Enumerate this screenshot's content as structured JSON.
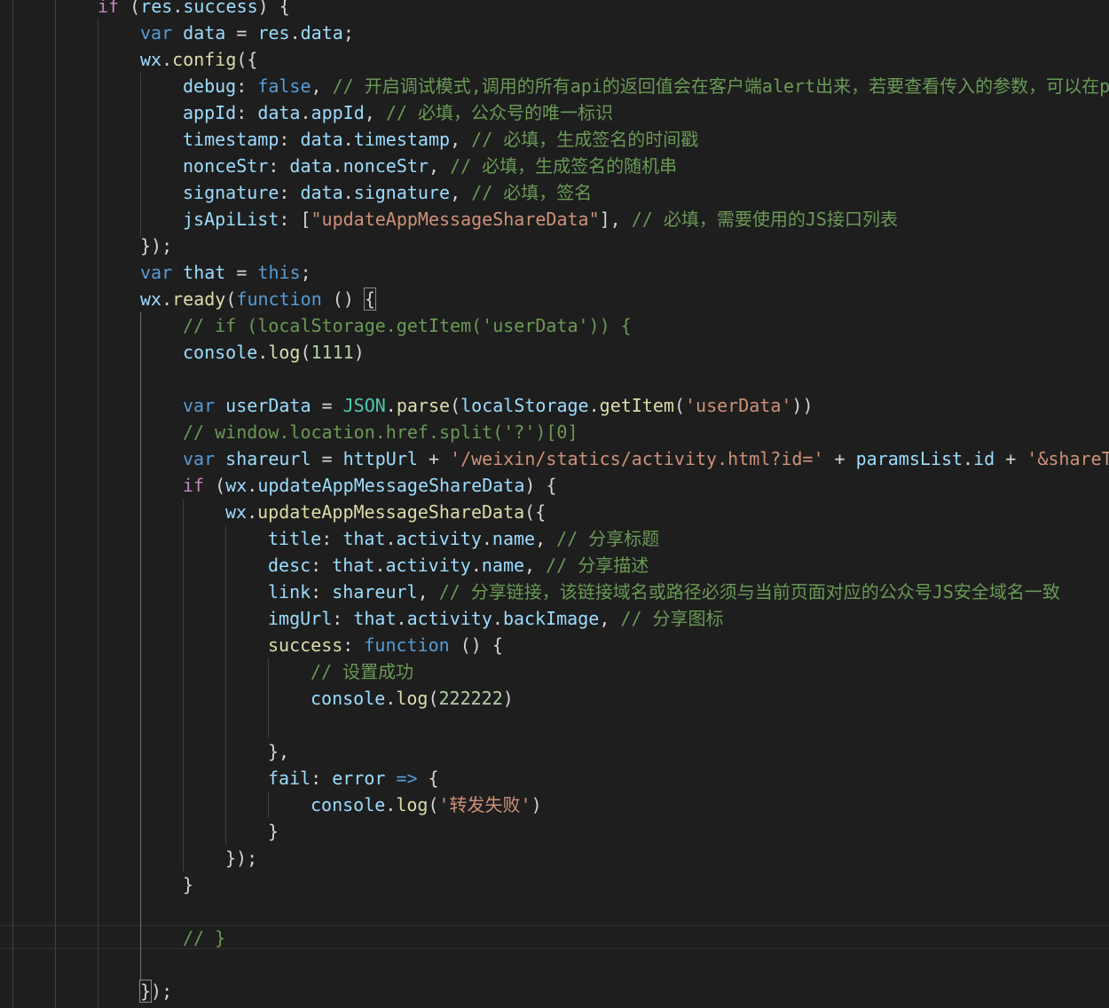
{
  "editor": {
    "lines": [
      {
        "indent": 110,
        "tokens": [
          {
            "t": "if",
            "c": "ctl"
          },
          {
            "t": " (",
            "c": "p"
          },
          {
            "t": "res",
            "c": "var"
          },
          {
            "t": ".",
            "c": "p"
          },
          {
            "t": "success",
            "c": "var"
          },
          {
            "t": ") {",
            "c": "p"
          }
        ]
      },
      {
        "indent": 158,
        "tokens": [
          {
            "t": "var",
            "c": "kw"
          },
          {
            "t": " ",
            "c": "p"
          },
          {
            "t": "data",
            "c": "var"
          },
          {
            "t": " = ",
            "c": "p"
          },
          {
            "t": "res",
            "c": "var"
          },
          {
            "t": ".",
            "c": "p"
          },
          {
            "t": "data",
            "c": "var"
          },
          {
            "t": ";",
            "c": "p"
          }
        ]
      },
      {
        "indent": 158,
        "tokens": [
          {
            "t": "wx",
            "c": "var"
          },
          {
            "t": ".",
            "c": "p"
          },
          {
            "t": "config",
            "c": "fn"
          },
          {
            "t": "({",
            "c": "p"
          }
        ]
      },
      {
        "indent": 206,
        "tokens": [
          {
            "t": "debug",
            "c": "var"
          },
          {
            "t": ": ",
            "c": "p"
          },
          {
            "t": "false",
            "c": "kw"
          },
          {
            "t": ", ",
            "c": "p"
          },
          {
            "t": "// 开启调试模式,调用的所有api的返回值会在客户端alert出来，若要查看传入的参数，可以在pc",
            "c": "cmt"
          }
        ]
      },
      {
        "indent": 206,
        "tokens": [
          {
            "t": "appId",
            "c": "var"
          },
          {
            "t": ": ",
            "c": "p"
          },
          {
            "t": "data",
            "c": "var"
          },
          {
            "t": ".",
            "c": "p"
          },
          {
            "t": "appId",
            "c": "var"
          },
          {
            "t": ", ",
            "c": "p"
          },
          {
            "t": "// 必填，公众号的唯一标识",
            "c": "cmt"
          }
        ]
      },
      {
        "indent": 206,
        "tokens": [
          {
            "t": "timestamp",
            "c": "var"
          },
          {
            "t": ": ",
            "c": "p"
          },
          {
            "t": "data",
            "c": "var"
          },
          {
            "t": ".",
            "c": "p"
          },
          {
            "t": "timestamp",
            "c": "var"
          },
          {
            "t": ", ",
            "c": "p"
          },
          {
            "t": "// 必填，生成签名的时间戳",
            "c": "cmt"
          }
        ]
      },
      {
        "indent": 206,
        "tokens": [
          {
            "t": "nonceStr",
            "c": "var"
          },
          {
            "t": ": ",
            "c": "p"
          },
          {
            "t": "data",
            "c": "var"
          },
          {
            "t": ".",
            "c": "p"
          },
          {
            "t": "nonceStr",
            "c": "var"
          },
          {
            "t": ", ",
            "c": "p"
          },
          {
            "t": "// 必填，生成签名的随机串",
            "c": "cmt"
          }
        ]
      },
      {
        "indent": 206,
        "tokens": [
          {
            "t": "signature",
            "c": "var"
          },
          {
            "t": ": ",
            "c": "p"
          },
          {
            "t": "data",
            "c": "var"
          },
          {
            "t": ".",
            "c": "p"
          },
          {
            "t": "signature",
            "c": "var"
          },
          {
            "t": ", ",
            "c": "p"
          },
          {
            "t": "// 必填，签名",
            "c": "cmt"
          }
        ]
      },
      {
        "indent": 206,
        "tokens": [
          {
            "t": "jsApiList",
            "c": "var"
          },
          {
            "t": ": [",
            "c": "p"
          },
          {
            "t": "\"updateAppMessageShareData\"",
            "c": "str"
          },
          {
            "t": "], ",
            "c": "p"
          },
          {
            "t": "// 必填，需要使用的JS接口列表",
            "c": "cmt"
          }
        ]
      },
      {
        "indent": 158,
        "tokens": [
          {
            "t": "});",
            "c": "p"
          }
        ]
      },
      {
        "indent": 158,
        "tokens": [
          {
            "t": "var",
            "c": "kw"
          },
          {
            "t": " ",
            "c": "p"
          },
          {
            "t": "that",
            "c": "var"
          },
          {
            "t": " = ",
            "c": "p"
          },
          {
            "t": "this",
            "c": "kw"
          },
          {
            "t": ";",
            "c": "p"
          }
        ]
      },
      {
        "indent": 158,
        "tokens": [
          {
            "t": "wx",
            "c": "var"
          },
          {
            "t": ".",
            "c": "p"
          },
          {
            "t": "ready",
            "c": "fn"
          },
          {
            "t": "(",
            "c": "p"
          },
          {
            "t": "function",
            "c": "kw"
          },
          {
            "t": " () ",
            "c": "p"
          },
          {
            "t": "{",
            "c": "p",
            "match": true
          }
        ]
      },
      {
        "indent": 206,
        "tokens": [
          {
            "t": "// if (localStorage.getItem('userData')) {",
            "c": "cmt"
          }
        ]
      },
      {
        "indent": 206,
        "tokens": [
          {
            "t": "console",
            "c": "var"
          },
          {
            "t": ".",
            "c": "p"
          },
          {
            "t": "log",
            "c": "fn"
          },
          {
            "t": "(",
            "c": "p"
          },
          {
            "t": "1111",
            "c": "num"
          },
          {
            "t": ")",
            "c": "p"
          }
        ]
      },
      {
        "indent": 206,
        "tokens": []
      },
      {
        "indent": 206,
        "tokens": [
          {
            "t": "var",
            "c": "kw"
          },
          {
            "t": " ",
            "c": "p"
          },
          {
            "t": "userData",
            "c": "var"
          },
          {
            "t": " = ",
            "c": "p"
          },
          {
            "t": "JSON",
            "c": "cls"
          },
          {
            "t": ".",
            "c": "p"
          },
          {
            "t": "parse",
            "c": "fn"
          },
          {
            "t": "(",
            "c": "p"
          },
          {
            "t": "localStorage",
            "c": "var"
          },
          {
            "t": ".",
            "c": "p"
          },
          {
            "t": "getItem",
            "c": "fn"
          },
          {
            "t": "(",
            "c": "p"
          },
          {
            "t": "'userData'",
            "c": "str"
          },
          {
            "t": "))",
            "c": "p"
          }
        ]
      },
      {
        "indent": 206,
        "tokens": [
          {
            "t": "// window.location.href.split('?')[0]",
            "c": "cmt"
          }
        ]
      },
      {
        "indent": 206,
        "tokens": [
          {
            "t": "var",
            "c": "kw"
          },
          {
            "t": " ",
            "c": "p"
          },
          {
            "t": "shareurl",
            "c": "var"
          },
          {
            "t": " = ",
            "c": "p"
          },
          {
            "t": "httpUrl",
            "c": "var"
          },
          {
            "t": " + ",
            "c": "p"
          },
          {
            "t": "'/weixin/statics/activity.html?id='",
            "c": "str"
          },
          {
            "t": " + ",
            "c": "p"
          },
          {
            "t": "paramsList",
            "c": "var"
          },
          {
            "t": ".",
            "c": "p"
          },
          {
            "t": "id",
            "c": "var"
          },
          {
            "t": " + ",
            "c": "p"
          },
          {
            "t": "'&shareT",
            "c": "str"
          }
        ]
      },
      {
        "indent": 206,
        "tokens": [
          {
            "t": "if",
            "c": "ctl"
          },
          {
            "t": " (",
            "c": "p"
          },
          {
            "t": "wx",
            "c": "var"
          },
          {
            "t": ".",
            "c": "p"
          },
          {
            "t": "updateAppMessageShareData",
            "c": "var"
          },
          {
            "t": ") {",
            "c": "p"
          }
        ]
      },
      {
        "indent": 254,
        "tokens": [
          {
            "t": "wx",
            "c": "var"
          },
          {
            "t": ".",
            "c": "p"
          },
          {
            "t": "updateAppMessageShareData",
            "c": "fn"
          },
          {
            "t": "({",
            "c": "p"
          }
        ]
      },
      {
        "indent": 302,
        "tokens": [
          {
            "t": "title",
            "c": "var"
          },
          {
            "t": ": ",
            "c": "p"
          },
          {
            "t": "that",
            "c": "var"
          },
          {
            "t": ".",
            "c": "p"
          },
          {
            "t": "activity",
            "c": "var"
          },
          {
            "t": ".",
            "c": "p"
          },
          {
            "t": "name",
            "c": "var"
          },
          {
            "t": ", ",
            "c": "p"
          },
          {
            "t": "// 分享标题",
            "c": "cmt"
          }
        ]
      },
      {
        "indent": 302,
        "tokens": [
          {
            "t": "desc",
            "c": "var"
          },
          {
            "t": ": ",
            "c": "p"
          },
          {
            "t": "that",
            "c": "var"
          },
          {
            "t": ".",
            "c": "p"
          },
          {
            "t": "activity",
            "c": "var"
          },
          {
            "t": ".",
            "c": "p"
          },
          {
            "t": "name",
            "c": "var"
          },
          {
            "t": ", ",
            "c": "p"
          },
          {
            "t": "// 分享描述",
            "c": "cmt"
          }
        ]
      },
      {
        "indent": 302,
        "tokens": [
          {
            "t": "link",
            "c": "var"
          },
          {
            "t": ": ",
            "c": "p"
          },
          {
            "t": "shareurl",
            "c": "var"
          },
          {
            "t": ", ",
            "c": "p"
          },
          {
            "t": "// 分享链接，该链接域名或路径必须与当前页面对应的公众号JS安全域名一致",
            "c": "cmt"
          }
        ]
      },
      {
        "indent": 302,
        "tokens": [
          {
            "t": "imgUrl",
            "c": "var"
          },
          {
            "t": ": ",
            "c": "p"
          },
          {
            "t": "that",
            "c": "var"
          },
          {
            "t": ".",
            "c": "p"
          },
          {
            "t": "activity",
            "c": "var"
          },
          {
            "t": ".",
            "c": "p"
          },
          {
            "t": "backImage",
            "c": "var"
          },
          {
            "t": ", ",
            "c": "p"
          },
          {
            "t": "// 分享图标",
            "c": "cmt"
          }
        ]
      },
      {
        "indent": 302,
        "tokens": [
          {
            "t": "success",
            "c": "fn"
          },
          {
            "t": ": ",
            "c": "p"
          },
          {
            "t": "function",
            "c": "kw"
          },
          {
            "t": " () {",
            "c": "p"
          }
        ]
      },
      {
        "indent": 350,
        "tokens": [
          {
            "t": "// 设置成功",
            "c": "cmt"
          }
        ]
      },
      {
        "indent": 350,
        "tokens": [
          {
            "t": "console",
            "c": "var"
          },
          {
            "t": ".",
            "c": "p"
          },
          {
            "t": "log",
            "c": "fn"
          },
          {
            "t": "(",
            "c": "p"
          },
          {
            "t": "222222",
            "c": "num"
          },
          {
            "t": ")",
            "c": "p"
          }
        ]
      },
      {
        "indent": 350,
        "tokens": []
      },
      {
        "indent": 302,
        "tokens": [
          {
            "t": "},",
            "c": "p"
          }
        ]
      },
      {
        "indent": 302,
        "tokens": [
          {
            "t": "fail",
            "c": "var"
          },
          {
            "t": ": ",
            "c": "p"
          },
          {
            "t": "error",
            "c": "var"
          },
          {
            "t": " ",
            "c": "p"
          },
          {
            "t": "=>",
            "c": "kw"
          },
          {
            "t": " {",
            "c": "p"
          }
        ]
      },
      {
        "indent": 350,
        "tokens": [
          {
            "t": "console",
            "c": "var"
          },
          {
            "t": ".",
            "c": "p"
          },
          {
            "t": "log",
            "c": "fn"
          },
          {
            "t": "(",
            "c": "p"
          },
          {
            "t": "'转发失败'",
            "c": "str"
          },
          {
            "t": ")",
            "c": "p"
          }
        ]
      },
      {
        "indent": 302,
        "tokens": [
          {
            "t": "}",
            "c": "p"
          }
        ]
      },
      {
        "indent": 254,
        "tokens": [
          {
            "t": "});",
            "c": "p"
          }
        ]
      },
      {
        "indent": 206,
        "tokens": [
          {
            "t": "}",
            "c": "p"
          }
        ]
      },
      {
        "indent": 206,
        "tokens": []
      },
      {
        "indent": 206,
        "tokens": [
          {
            "t": "// }",
            "c": "cmt"
          }
        ]
      },
      {
        "indent": 158,
        "tokens": []
      },
      {
        "indent": 158,
        "tokens": [
          {
            "t": "}",
            "c": "p",
            "match": true
          },
          {
            "t": ");",
            "c": "p"
          }
        ]
      }
    ]
  }
}
